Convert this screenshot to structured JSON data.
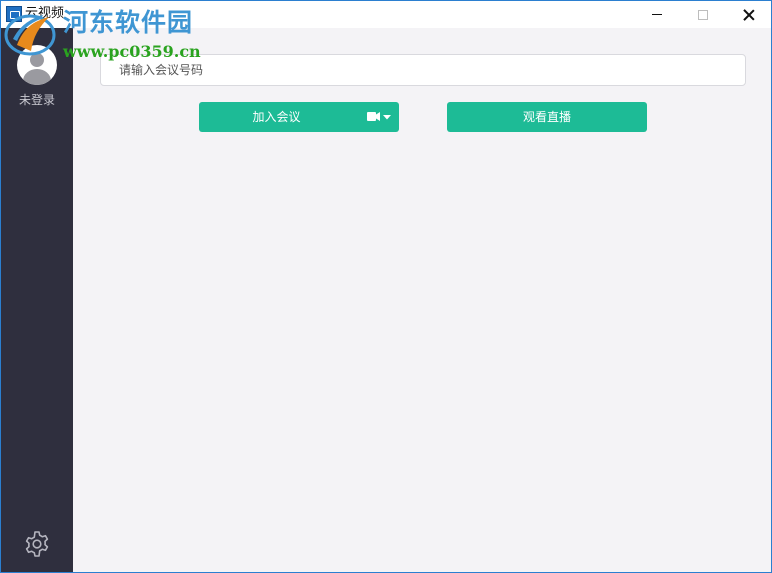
{
  "window": {
    "title": "云视频",
    "minimize_symbol": "",
    "maximize_symbol": "",
    "close_symbol": ""
  },
  "watermark": {
    "site_name": "河东软件园",
    "url": "www.pc0359.cn",
    "colors": {
      "title": "#3f96d3",
      "url": "#2aa31f"
    }
  },
  "sidebar": {
    "login_status": "未登录",
    "avatar_icon": "user-avatar-icon",
    "settings_icon": "gear-icon"
  },
  "main": {
    "meeting_number_placeholder": "请输入会议号码",
    "meeting_number_value": "",
    "join_button_label": "加入会议",
    "video_dropdown_icon": "video-camera-icon",
    "watch_live_button_label": "观看直播"
  },
  "colors": {
    "accent": "#1dbb96",
    "sidebar_bg": "#2f2f3e",
    "main_bg": "#f4f3f6",
    "window_border": "#2b7fd0"
  }
}
